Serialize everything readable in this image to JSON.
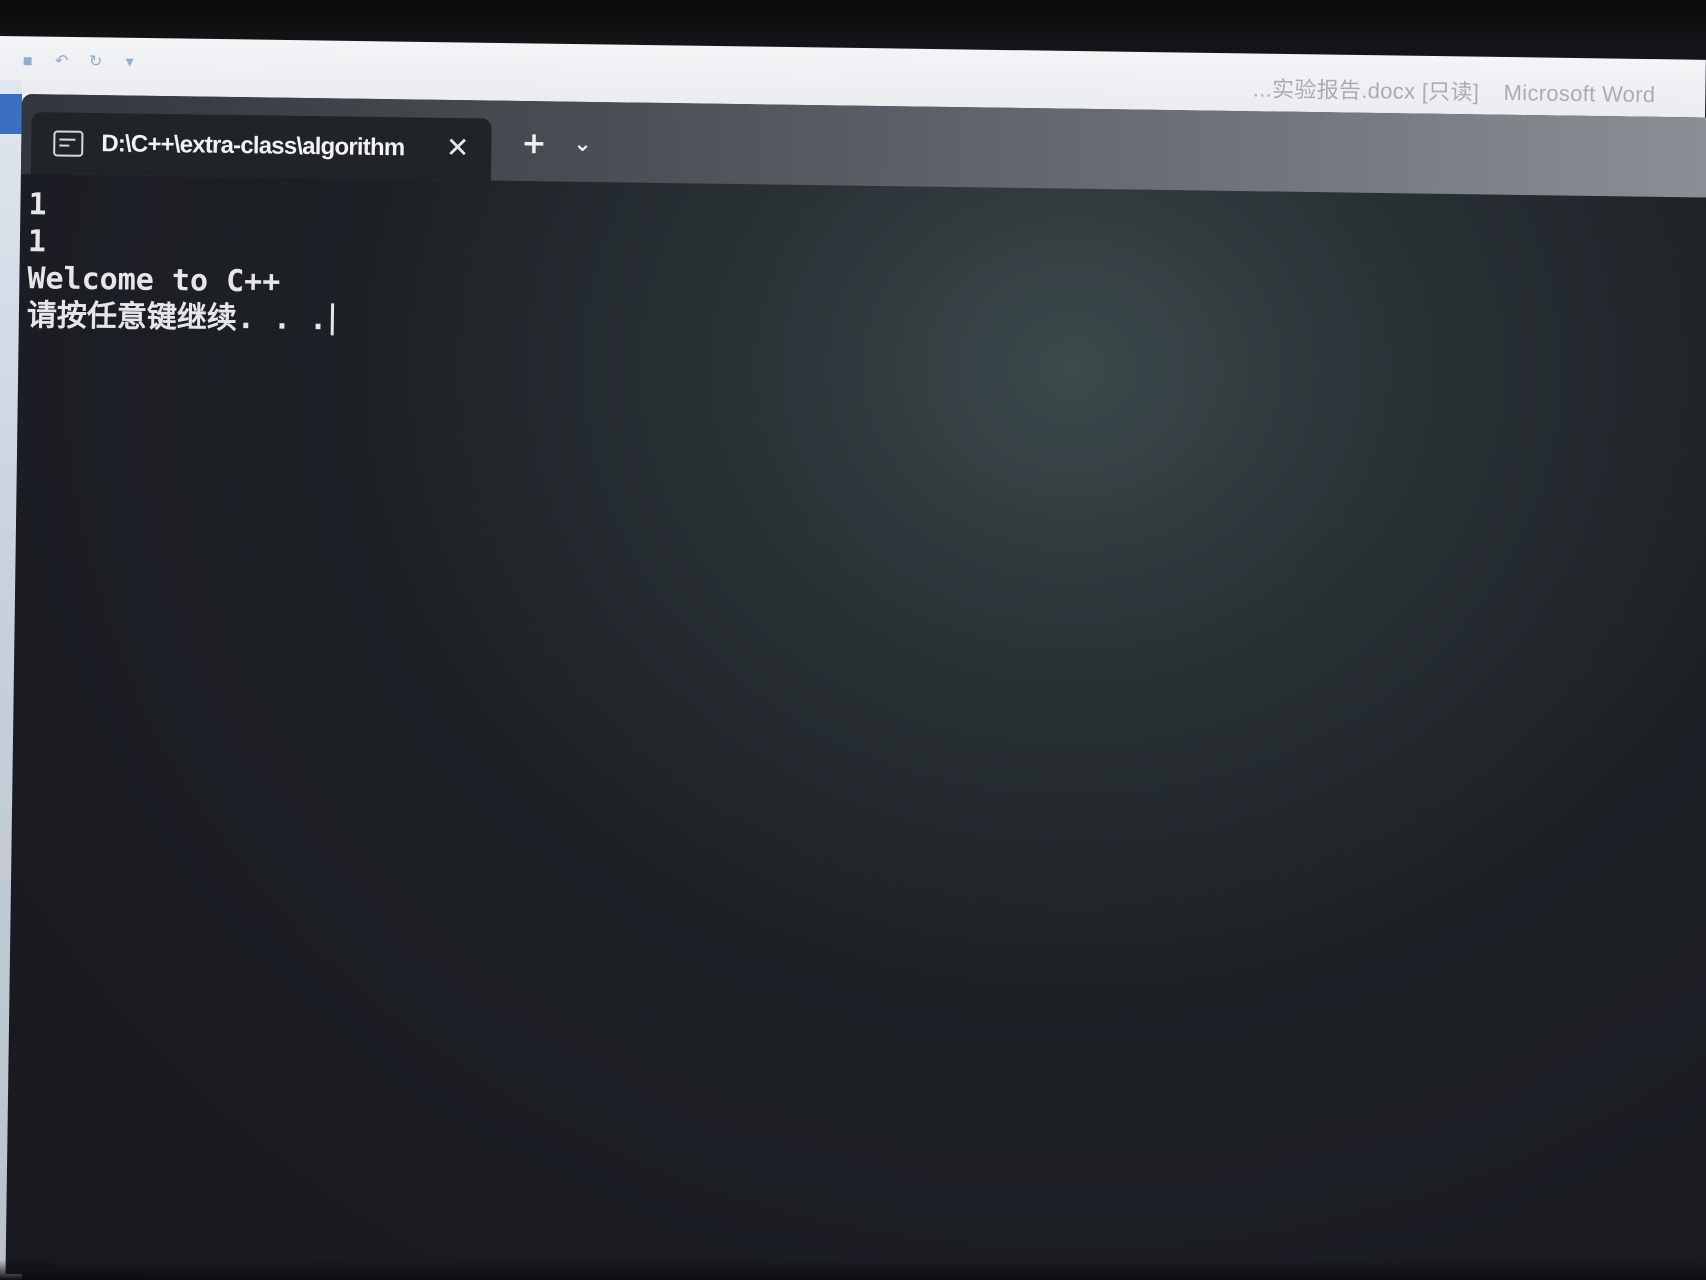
{
  "word_window": {
    "document_title": "...实验报告.docx [只读]",
    "app_name": "Microsoft Word",
    "quick_access": [
      {
        "icon": "save-icon",
        "glyph": "▪"
      },
      {
        "icon": "undo-icon",
        "glyph": "↶"
      },
      {
        "icon": "redo-icon",
        "glyph": "↻"
      },
      {
        "icon": "customize-icon",
        "glyph": "▾"
      }
    ]
  },
  "terminal": {
    "tab": {
      "title": "D:\\C++\\extra-class\\algorithm",
      "close_glyph": "✕"
    },
    "new_tab_glyph": "+",
    "dropdown_glyph": "⌄",
    "output_lines": [
      "1",
      "1",
      "Welcome to C++",
      "请按任意键继续. . ."
    ]
  },
  "colors": {
    "terminal_bg": "#1a1c22",
    "tab_bg": "#202327",
    "text": "#e4e6e8"
  }
}
